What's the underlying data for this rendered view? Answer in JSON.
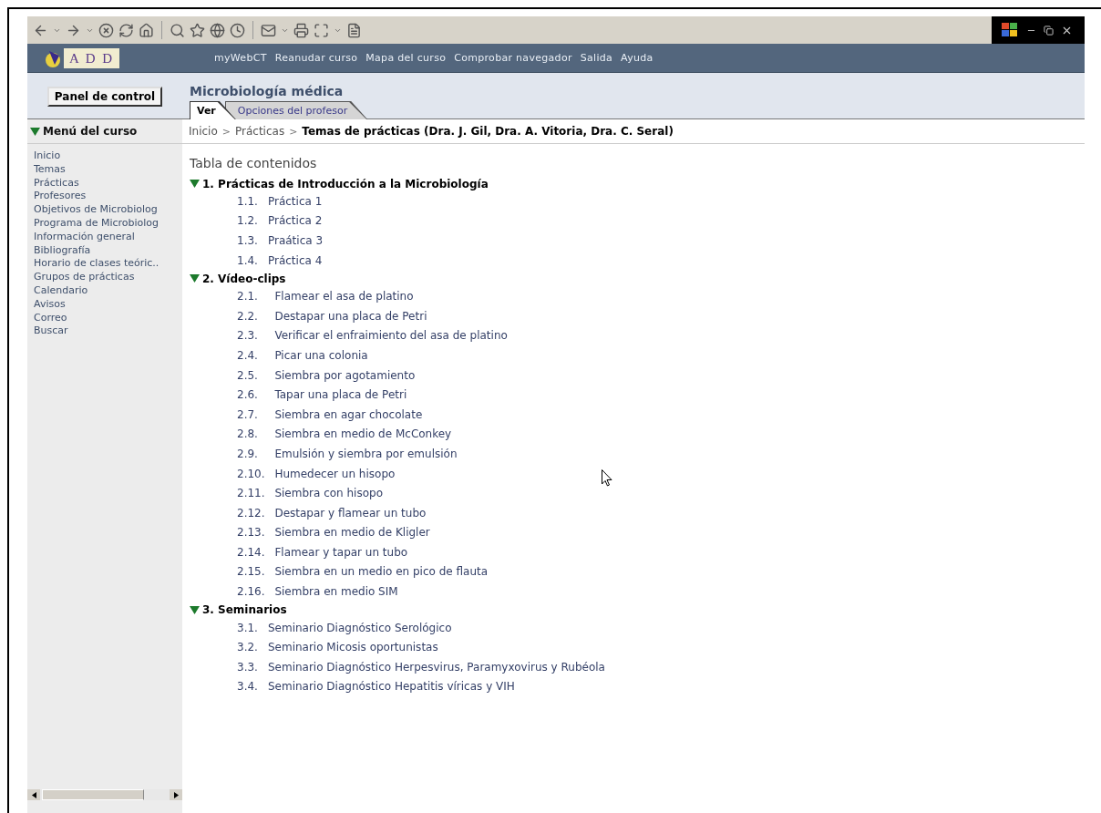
{
  "logo": {
    "text": "A D D"
  },
  "nav": {
    "links": [
      "myWebCT",
      "Reanudar curso",
      "Mapa del curso",
      "Comprobar navegador",
      "Salida",
      "Ayuda"
    ]
  },
  "header": {
    "panel_button": "Panel de control",
    "course_title": "Microbiología médica",
    "tabs": [
      {
        "label": "Ver",
        "selected": true
      },
      {
        "label": "Opciones del profesor",
        "selected": false
      }
    ]
  },
  "sidebar": {
    "title": "Menú del curso",
    "expanded": true,
    "items": [
      "Inicio",
      "Temas",
      "Prácticas",
      "Profesores",
      "Objetivos de Microbiolog",
      "Programa de Microbiolog",
      "Información general",
      "Bibliografía",
      "Horario de clases teóric..",
      "Grupos de prácticas",
      "Calendario",
      "Avisos",
      "Correo",
      "Buscar"
    ]
  },
  "breadcrumb": {
    "links": [
      "Inicio",
      "Prácticas"
    ],
    "separator": ">",
    "current": "Temas de prácticas (Dra. J. Gil, Dra. A. Vitoria, Dra. C. Seral)"
  },
  "toc": {
    "title": "Tabla de contenidos",
    "sections": [
      {
        "title": "1. Prácticas de Introducción a la Microbiología",
        "expanded": true,
        "children": [
          {
            "number": "1.1.",
            "label": "Práctica 1"
          },
          {
            "number": "1.2.",
            "label": "Práctica 2"
          },
          {
            "number": "1.3.",
            "label": "Praática 3"
          },
          {
            "number": "1.4.",
            "label": "Práctica 4"
          }
        ]
      },
      {
        "title": "2. Vídeo-clips",
        "expanded": true,
        "children": [
          {
            "number": "2.1.",
            "label": "Flamear el asa de platino"
          },
          {
            "number": "2.2.",
            "label": "Destapar una placa de Petri"
          },
          {
            "number": "2.3.",
            "label": "Verificar el enfraimiento del asa de platino"
          },
          {
            "number": "2.4.",
            "label": "Picar una colonia"
          },
          {
            "number": "2.5.",
            "label": "Siembra por agotamiento"
          },
          {
            "number": "2.6.",
            "label": "Tapar una placa de Petri"
          },
          {
            "number": "2.7.",
            "label": "Siembra en agar chocolate"
          },
          {
            "number": "2.8.",
            "label": "Siembra en medio de McConkey"
          },
          {
            "number": "2.9.",
            "label": "Emulsión y siembra por emulsión"
          },
          {
            "number": "2.10.",
            "label": "Humedecer un hisopo"
          },
          {
            "number": "2.11.",
            "label": "Siembra con hisopo"
          },
          {
            "number": "2.12.",
            "label": "Destapar y flamear un tubo"
          },
          {
            "number": "2.13.",
            "label": "Siembra en medio de Kligler"
          },
          {
            "number": "2.14.",
            "label": "Flamear y tapar un tubo"
          },
          {
            "number": "2.15.",
            "label": "Siembra en un medio en pico de flauta"
          },
          {
            "number": "2.16.",
            "label": "Siembra en medio SIM"
          }
        ]
      },
      {
        "title": "3. Seminarios",
        "expanded": true,
        "children": [
          {
            "number": "3.1.",
            "label": "Seminario Diagnóstico Serológico"
          },
          {
            "number": "3.2.",
            "label": "Seminario Micosis oportunistas"
          },
          {
            "number": "3.3.",
            "label": "Seminario Diagnóstico Herpesvirus, Paramyxovirus y Rubéola"
          },
          {
            "number": "3.4.",
            "label": "Seminario Diagnóstico Hepatitis víricas y VIH"
          }
        ]
      }
    ]
  }
}
